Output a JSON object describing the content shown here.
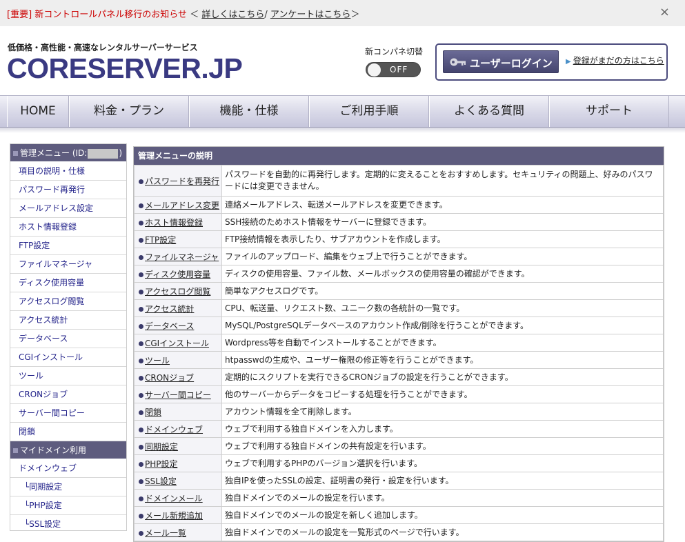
{
  "notice": {
    "tag": "[重要]",
    "headline": "新コントロールパネル移行のお知らせ",
    "prefix": "＜",
    "link_details": "詳しくはこちら",
    "separator": "/",
    "link_survey": "アンケートはこちら",
    "suffix": "＞",
    "close": "×"
  },
  "header": {
    "tagline": "低価格・高性能・高速なレンタルサーバーサービス",
    "logo": "CORESERVER.JP",
    "toggle_label": "新コンパネ切替",
    "toggle_state": "OFF",
    "login_button": "ユーザーログイン",
    "register_link": "登録がまだの方はこちら"
  },
  "nav": [
    {
      "label": "HOME"
    },
    {
      "label": "料金・プラン"
    },
    {
      "label": "機能・仕様"
    },
    {
      "label": "ご利用手順"
    },
    {
      "label": "よくある質問"
    },
    {
      "label": "サポート"
    }
  ],
  "sidebar": {
    "header_prefix": "管理メニュー (ID:",
    "header_suffix": ")",
    "items": [
      "項目の説明・仕様",
      "パスワード再発行",
      "メールアドレス設定",
      "ホスト情報登録",
      "FTP設定",
      "ファイルマネージャ",
      "ディスク使用容量",
      "アクセスログ閲覧",
      "アクセス統計",
      "データベース",
      "CGIインストール",
      "ツール",
      "CRONジョブ",
      "サーバー間コピー",
      "閉鎖"
    ],
    "section2_header": "マイドメイン利用",
    "section2_items": [
      "ドメインウェブ",
      "└同期設定",
      "└PHP設定",
      "└SSL設定"
    ]
  },
  "content": {
    "title": "管理メニューの説明",
    "rows": [
      {
        "name": "パスワードを再発行",
        "desc": "パスワードを自動的に再発行します。定期的に変えることをおすすめします。セキュリティの問題上、好みのパスワードには変更できません。"
      },
      {
        "name": "メールアドレス変更",
        "desc": "連絡メールアドレス、転送メールアドレスを変更できます。"
      },
      {
        "name": "ホスト情報登録",
        "desc": "SSH接続のためホスト情報をサーバーに登録できます。"
      },
      {
        "name": "FTP設定",
        "desc": "FTP接続情報を表示したり、サブアカウントを作成します。"
      },
      {
        "name": "ファイルマネージャ",
        "desc": "ファイルのアップロード、編集をウェブ上で行うことができます。"
      },
      {
        "name": "ディスク使用容量",
        "desc": "ディスクの使用容量、ファイル数、メールボックスの使用容量の確認ができます。"
      },
      {
        "name": "アクセスログ閲覧",
        "desc": "簡単なアクセスログです。"
      },
      {
        "name": "アクセス統計",
        "desc": "CPU、転送量、リクエスト数、ユニーク数の各統計の一覧です。"
      },
      {
        "name": "データベース",
        "desc": "MySQL/PostgreSQLデータベースのアカウント作成/削除を行うことができます。"
      },
      {
        "name": "CGIインストール",
        "desc": "Wordpress等を自動でインストールすることができます。"
      },
      {
        "name": "ツール",
        "desc": "htpasswdの生成や、ユーザー権限の修正等を行うことができます。"
      },
      {
        "name": "CRONジョブ",
        "desc": "定期的にスクリプトを実行できるCRONジョブの設定を行うことができます。"
      },
      {
        "name": "サーバー間コピー",
        "desc": "他のサーバーからデータをコピーする処理を行うことができます。"
      },
      {
        "name": "閉鎖",
        "desc": "アカウント情報を全て削除します。"
      },
      {
        "name": "ドメインウェブ",
        "desc": "ウェブで利用する独自ドメインを入力します。"
      },
      {
        "name": "同期設定",
        "desc": "ウェブで利用する独自ドメインの共有設定を行います。"
      },
      {
        "name": "PHP設定",
        "desc": "ウェブで利用するPHPのバージョン選択を行います。"
      },
      {
        "name": "SSL設定",
        "desc": "独自IPを使ったSSLの設定、証明書の発行・設定を行います。"
      },
      {
        "name": "ドメインメール",
        "desc": "独自ドメインでのメールの設定を行います。"
      },
      {
        "name": "メール新規追加",
        "desc": "独自ドメインでのメールの設定を新しく追加します。"
      },
      {
        "name": "メール一覧",
        "desc": "独自ドメインでのメールの設定を一覧形式のページで行います。"
      }
    ]
  }
}
